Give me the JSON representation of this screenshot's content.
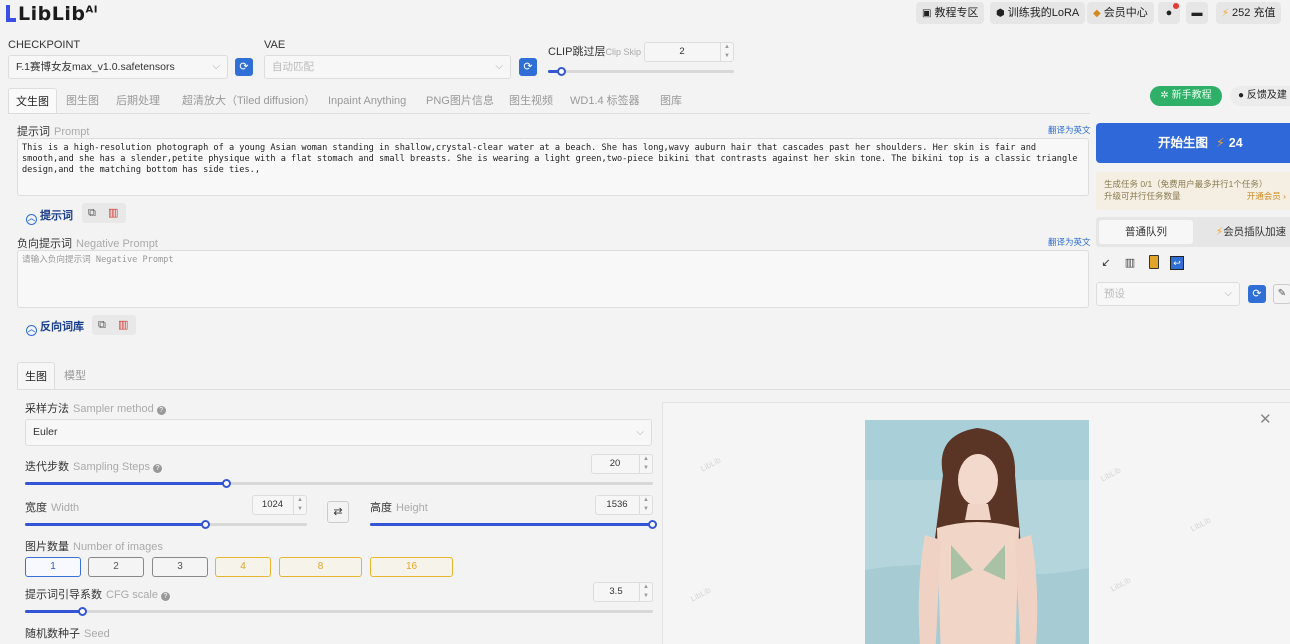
{
  "header": {
    "logo_text": "LibLib",
    "logo_sup": "AI",
    "buttons": {
      "tutorials": "教程专区",
      "train_lora": "训练我的LoRA",
      "member": "会员中心",
      "credits": "252 充值"
    }
  },
  "checkpoint": {
    "label": "CHECKPOINT",
    "value": "F.1赛博女友max_v1.0.safetensors"
  },
  "vae": {
    "label": "VAE",
    "value": "自动匹配"
  },
  "clip": {
    "label": "CLIP跳过层",
    "label_en": "Clip Skip",
    "value": "2",
    "fraction": 0.07
  },
  "tabs": [
    "文生图",
    "图生图",
    "后期处理",
    "超清放大（Tiled diffusion）",
    "Inpaint Anything",
    "PNG图片信息",
    "图生视频",
    "WD1.4 标签器",
    "图库"
  ],
  "top_right": {
    "tutorial_button": "新手教程",
    "feedback_button": "反馈及建"
  },
  "prompt": {
    "label": "提示词",
    "label_en": "Prompt",
    "translate": "翻译为英文",
    "text": "This is a high-resolution photograph of a young Asian woman standing in shallow,crystal-clear water at a beach. She has long,wavy auburn hair that cascades past her shoulders. Her skin is fair and smooth,and she has a slender,petite physique with a flat stomach and small breasts. She is wearing a light green,two-piece bikini that contrasts against her skin tone. The bikini top is a classic triangle design,and the matching bottom has side ties.,",
    "toggle": "提示词"
  },
  "negative": {
    "label": "负向提示词",
    "label_en": "Negative Prompt",
    "translate": "翻译为英文",
    "placeholder": "请输入负向提示词 Negative Prompt",
    "toggle": "反向词库"
  },
  "right_panel": {
    "generate_label": "开始生图",
    "generate_cost": "24",
    "notice_line1": "生成任务 0/1（免费用户最多并行1个任务）",
    "notice_line2": "升级可并行任务数量",
    "notice_link": "开通会员 ›",
    "queue_normal": "普通队列",
    "queue_vip": "会员插队加速",
    "preset_placeholder": "预设"
  },
  "subtabs": [
    "生图",
    "模型"
  ],
  "sampler": {
    "label": "采样方法",
    "label_en": "Sampler method",
    "value": "Euler"
  },
  "steps": {
    "label": "迭代步数",
    "label_en": "Sampling Steps",
    "value": "20",
    "fraction": 0.32
  },
  "width": {
    "label": "宽度",
    "label_en": "Width",
    "value": "1024",
    "fraction": 0.64
  },
  "height": {
    "label": "高度",
    "label_en": "Height",
    "value": "1536",
    "fraction": 1.0
  },
  "image_count": {
    "label": "图片数量",
    "label_en": "Number of images",
    "options": [
      "1",
      "2",
      "3",
      "4",
      "8",
      "16"
    ],
    "selected": "1"
  },
  "cfg": {
    "label": "提示词引导系数",
    "label_en": "CFG scale",
    "value": "3.5",
    "fraction": 0.09
  },
  "seed": {
    "label": "随机数种子",
    "label_en": "Seed"
  },
  "colors": {
    "accent": "#3355d6",
    "green": "#2fb069",
    "gold": "#e8b530",
    "danger": "#d03a2f"
  }
}
